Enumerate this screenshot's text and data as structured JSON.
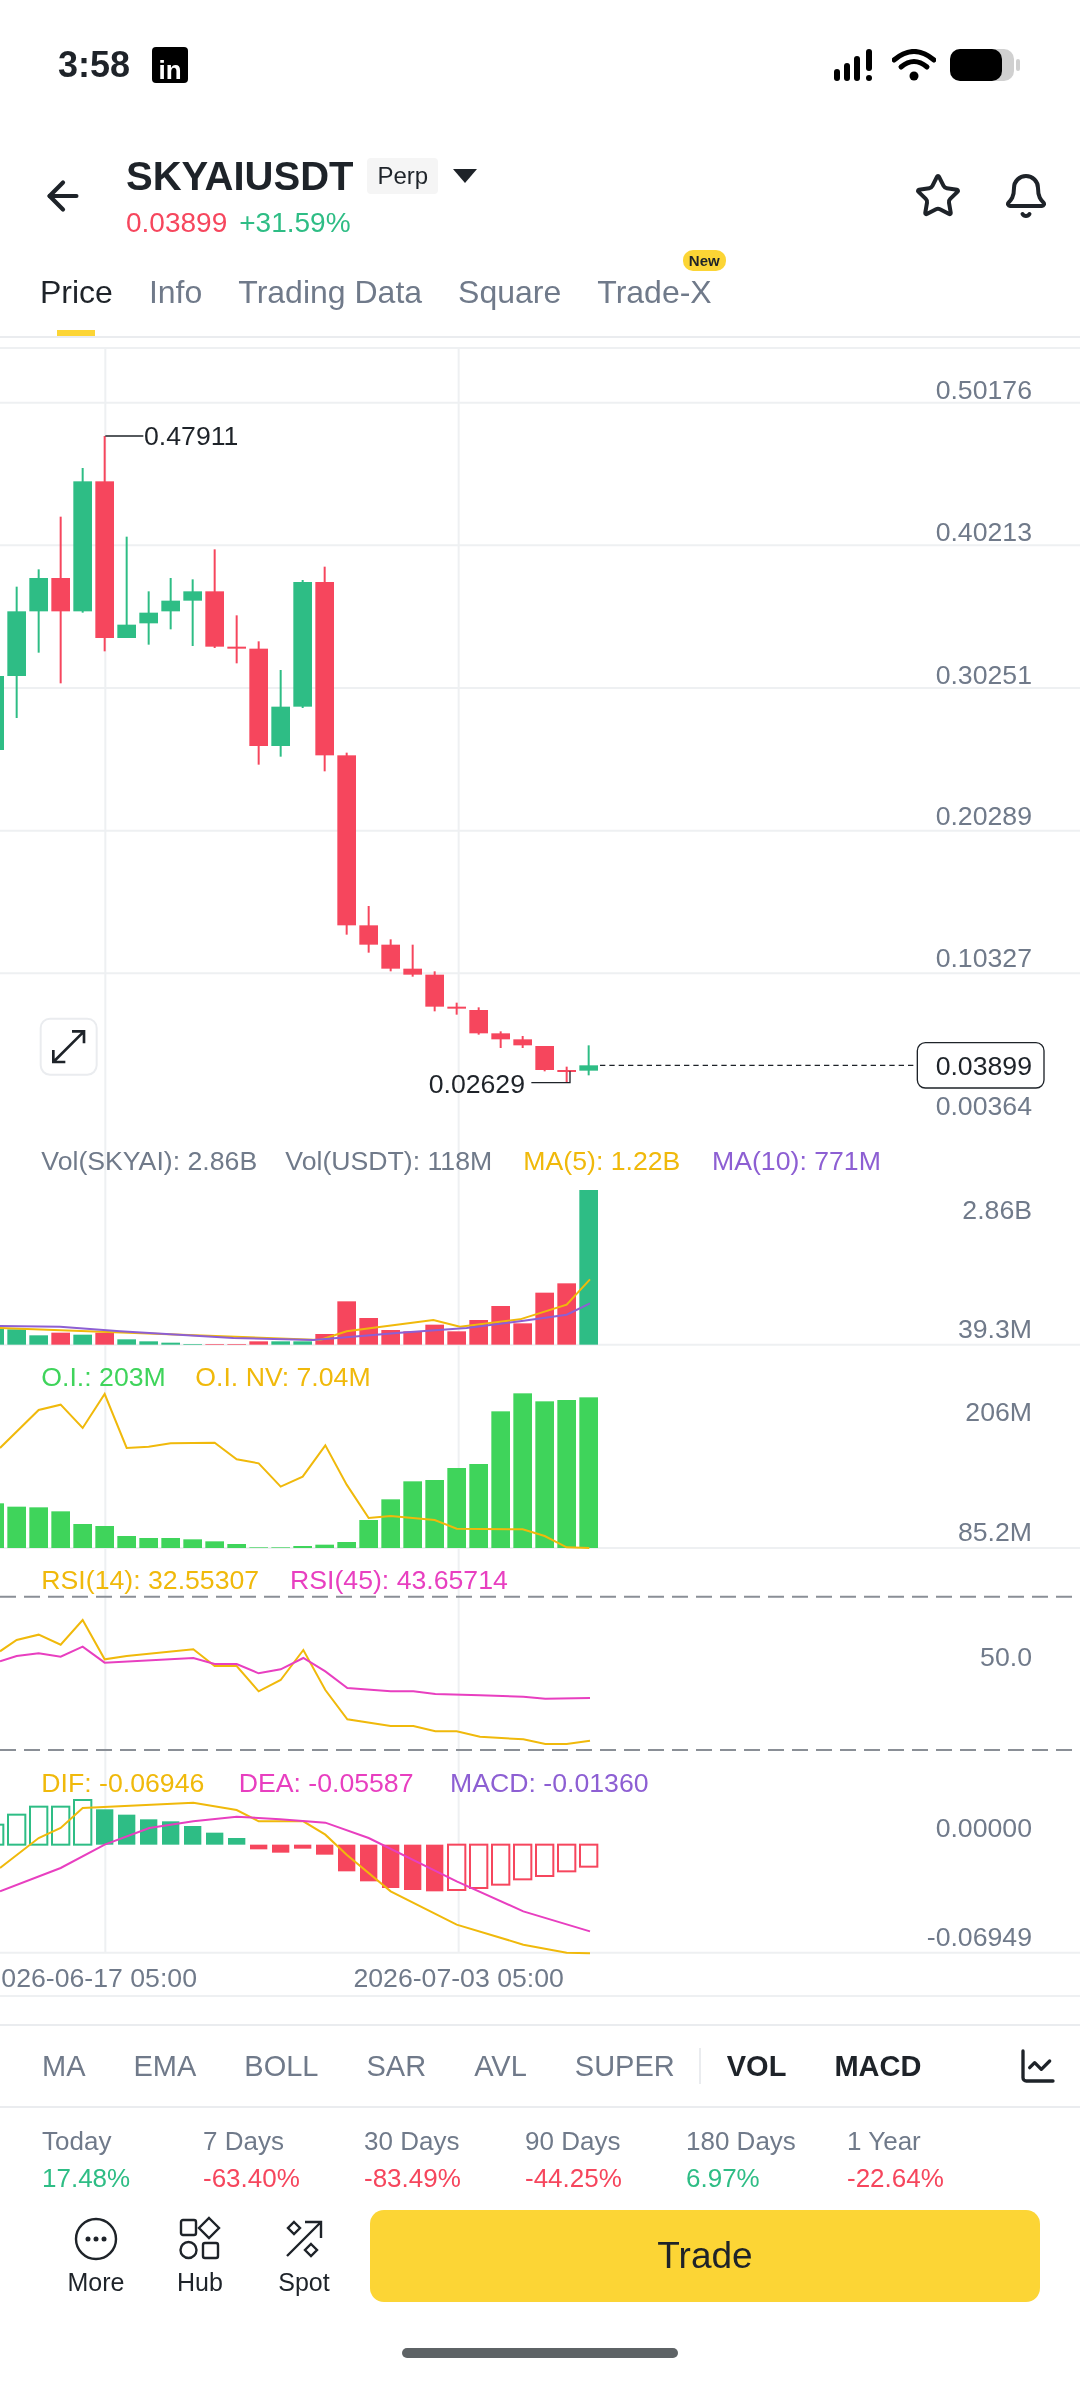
{
  "status_bar": {
    "time": "3:58",
    "app_badge": "in"
  },
  "header": {
    "symbol": "SKYAIUSDT",
    "contract_type": "Perp",
    "price": "0.03899",
    "change": "+31.59%"
  },
  "tabs": [
    {
      "label": "Price",
      "selected": true
    },
    {
      "label": "Info",
      "selected": false
    },
    {
      "label": "Trading Data",
      "selected": false
    },
    {
      "label": "Square",
      "selected": false
    },
    {
      "label": "Trade-X",
      "selected": false,
      "badge": "New"
    }
  ],
  "price_chart": {
    "price_axis": [
      "0.50176",
      "0.40213",
      "0.30251",
      "0.20289",
      "0.10327",
      "0.00364"
    ],
    "high_label": "0.47911",
    "low_label": "0.02629",
    "current_price": "0.03899"
  },
  "volume_panel": {
    "legend": [
      {
        "text": "Vol(SKYAI): 2.86B",
        "color": "#707a8a"
      },
      {
        "text": "Vol(USDT): 118M",
        "color": "#707a8a"
      },
      {
        "text": "MA(5): 1.22B",
        "color": "#f0b90b"
      },
      {
        "text": "MA(10): 771M",
        "color": "#8d5fd3"
      }
    ],
    "axis": [
      "2.86B",
      "39.3M"
    ]
  },
  "open_interest_panel": {
    "legend": [
      {
        "text": "O.I.: 203M",
        "color": "#3fd45b"
      },
      {
        "text": "O.I. NV: 7.04M",
        "color": "#f0b90b"
      }
    ],
    "axis": [
      "206M",
      "85.2M"
    ]
  },
  "rsi_panel": {
    "legend": [
      {
        "text": "RSI(14): 32.55307",
        "color": "#f0b90b"
      },
      {
        "text": "RSI(45): 43.65714",
        "color": "#e83fc0"
      }
    ],
    "axis": [
      "50.0"
    ]
  },
  "macd_panel": {
    "legend": [
      {
        "text": "DIF: -0.06946",
        "color": "#f0b90b"
      },
      {
        "text": "DEA: -0.05587",
        "color": "#e83fc0"
      },
      {
        "text": "MACD: -0.01360",
        "color": "#8d5fd3"
      }
    ],
    "axis": [
      "0.00000",
      "-0.06949"
    ]
  },
  "time_axis": [
    "026-06-17 05:00",
    "2026-07-03 05:00"
  ],
  "main_indicators": [
    {
      "label": "MA",
      "selected": false
    },
    {
      "label": "EMA",
      "selected": false
    },
    {
      "label": "BOLL",
      "selected": false
    },
    {
      "label": "SAR",
      "selected": false
    },
    {
      "label": "AVL",
      "selected": false
    },
    {
      "label": "SUPER",
      "selected": false
    }
  ],
  "sub_indicators": [
    {
      "label": "VOL",
      "selected": true
    },
    {
      "label": "MACD",
      "selected": true
    }
  ],
  "performance": [
    {
      "period": "Today",
      "change": "17.48%",
      "color": "#2ebd85"
    },
    {
      "period": "7 Days",
      "change": "-63.40%",
      "color": "#f6465d"
    },
    {
      "period": "30 Days",
      "change": "-83.49%",
      "color": "#f6465d"
    },
    {
      "period": "90 Days",
      "change": "-44.25%",
      "color": "#f6465d"
    },
    {
      "period": "180 Days",
      "change": "6.97%",
      "color": "#2ebd85"
    },
    {
      "period": "1 Year",
      "change": "-22.64%",
      "color": "#f6465d"
    }
  ],
  "bottom_bar": {
    "actions": [
      {
        "label": "More",
        "kind": "more"
      },
      {
        "label": "Hub",
        "kind": "hub"
      },
      {
        "label": "Spot",
        "kind": "spot"
      }
    ],
    "primary_button": "Trade"
  }
}
